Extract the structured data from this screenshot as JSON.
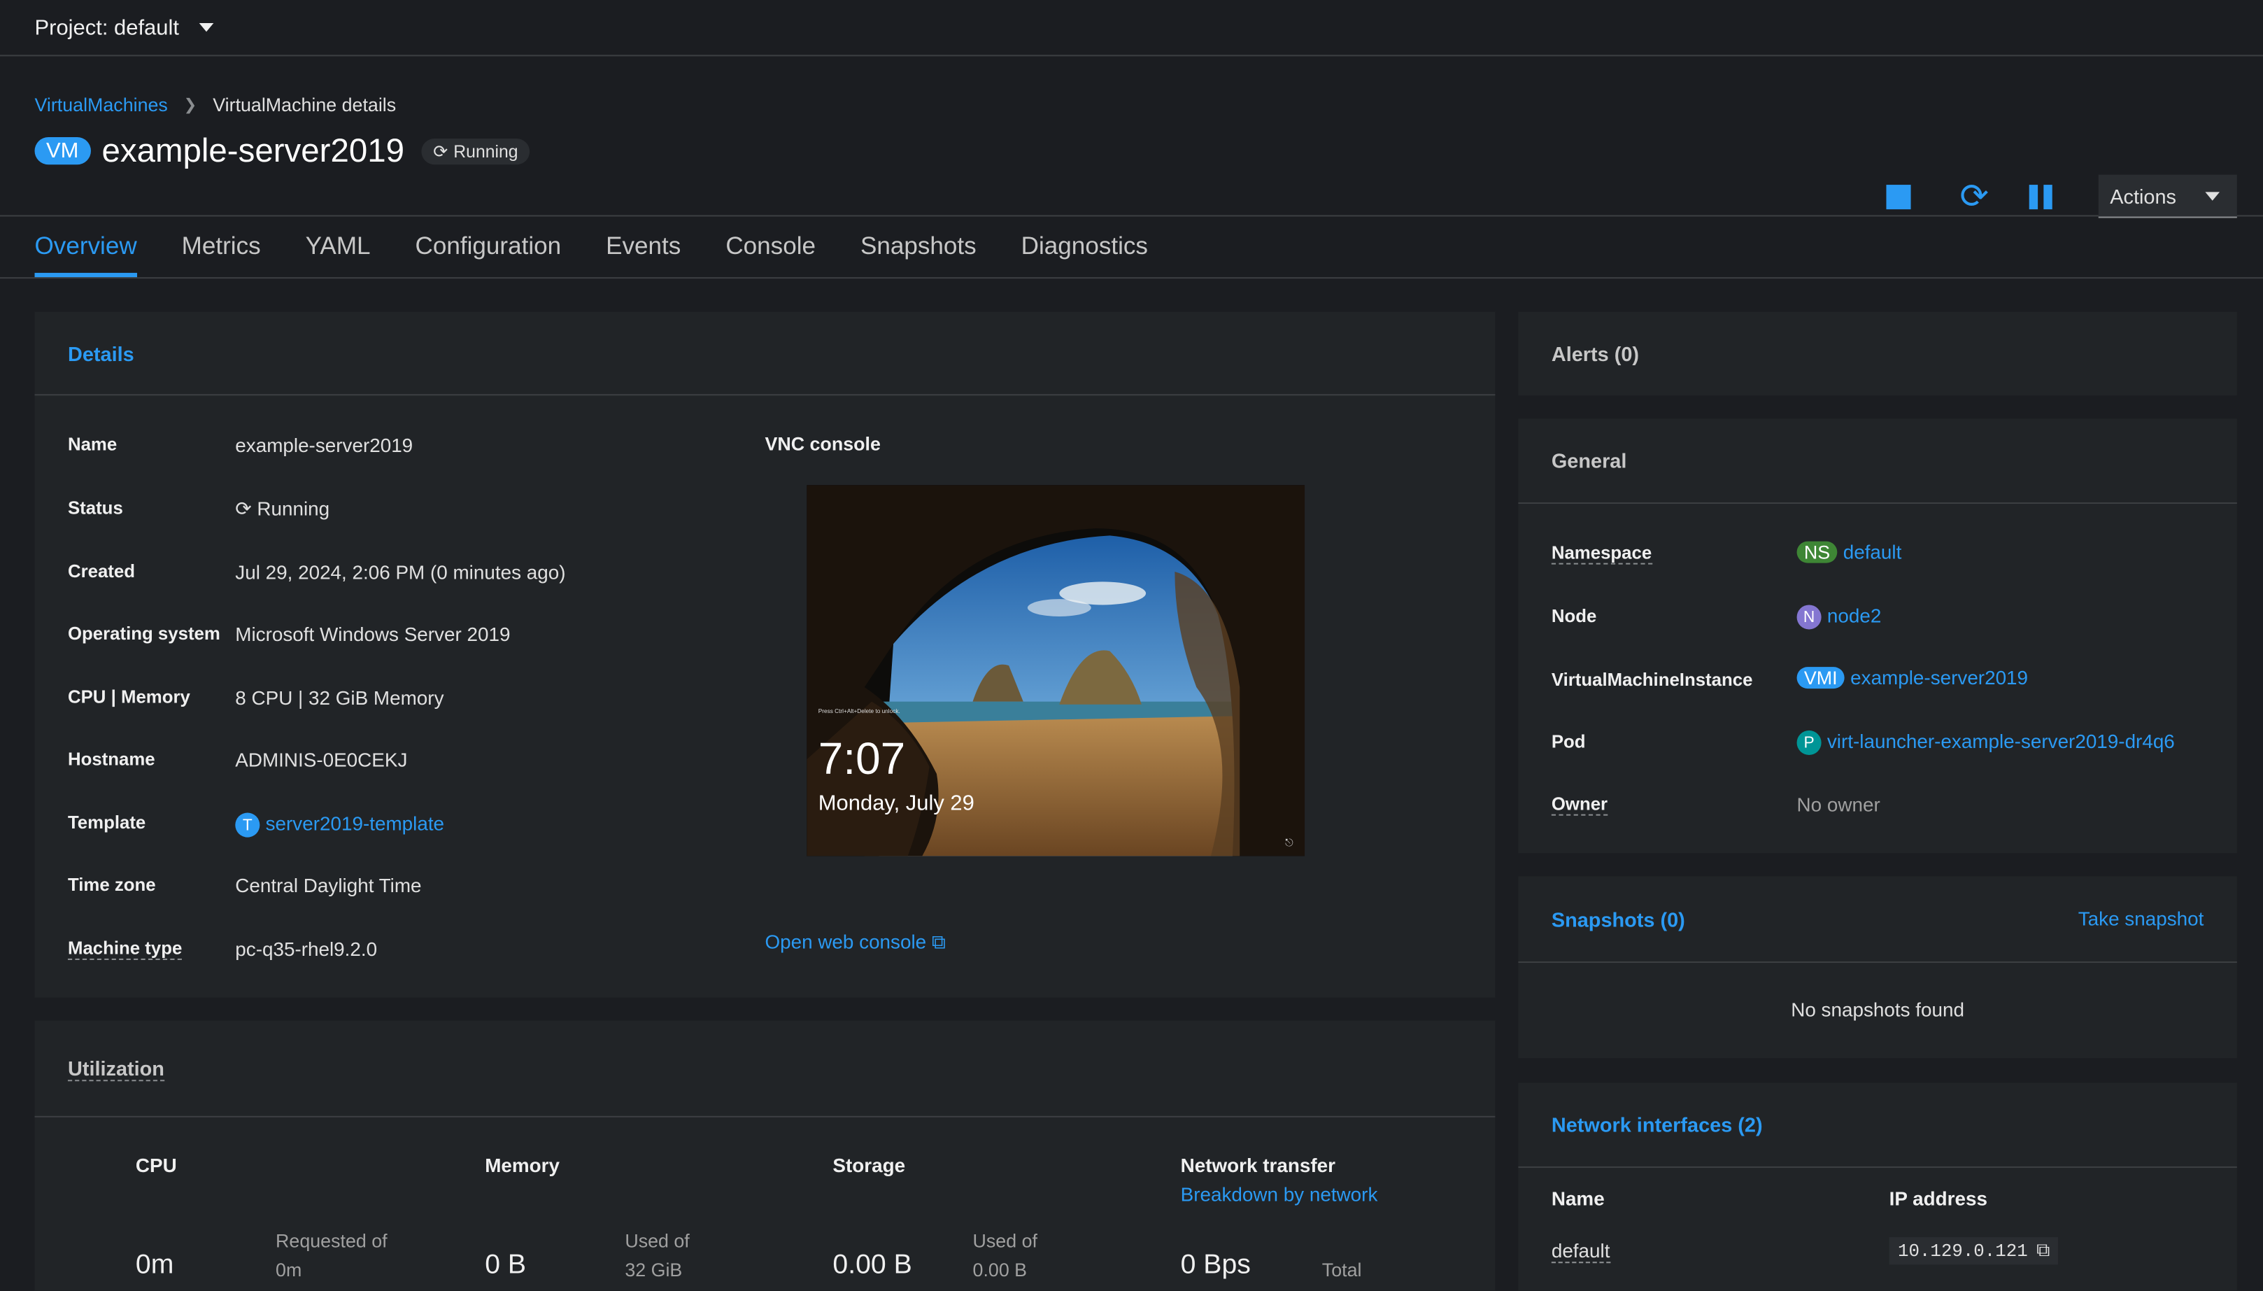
{
  "project": {
    "label": "Project: default"
  },
  "breadcrumb": {
    "parent": "VirtualMachines",
    "current": "VirtualMachine details"
  },
  "vm": {
    "badge": "VM",
    "name": "example-server2019",
    "status": "Running"
  },
  "header_actions": {
    "actions_label": "Actions",
    "stop": "stop-icon",
    "restart": "restart-icon",
    "pause": "pause-icon"
  },
  "tabs": [
    "Overview",
    "Metrics",
    "YAML",
    "Configuration",
    "Events",
    "Console",
    "Snapshots",
    "Diagnostics"
  ],
  "details": {
    "title": "Details",
    "rows": [
      {
        "label": "Name",
        "value": "example-server2019"
      },
      {
        "label": "Status",
        "value": "Running"
      },
      {
        "label": "Created",
        "value": "Jul 29, 2024, 2:06 PM (0 minutes ago)"
      },
      {
        "label": "Operating system",
        "value": "Microsoft Windows Server 2019"
      },
      {
        "label": "CPU | Memory",
        "value": "8 CPU | 32 GiB Memory"
      },
      {
        "label": "Hostname",
        "value": "ADMINIS-0E0CEKJ"
      },
      {
        "label": "Template",
        "badge": "T",
        "value": "server2019-template"
      },
      {
        "label": "Time zone",
        "value": "Central Daylight Time"
      },
      {
        "label": "Machine type",
        "value": "pc-q35-rhel9.2.0"
      }
    ],
    "vnc": {
      "title": "VNC console",
      "hint": "Press Ctrl+Alt+Delete to unlock.",
      "time": "7:07",
      "date": "Monday, July 29",
      "open_link": "Open web console"
    }
  },
  "utilization": {
    "title": "Utilization",
    "cpu": {
      "title": "CPU",
      "value": "0m",
      "sub1": "Requested of",
      "sub2": "0m"
    },
    "memory": {
      "title": "Memory",
      "value": "0 B",
      "sub1": "Used of",
      "sub2": "32 GiB"
    },
    "storage": {
      "title": "Storage",
      "value": "0.00 B",
      "sub1": "Used of",
      "sub2": "0.00 B"
    },
    "network": {
      "title": "Network transfer",
      "link": "Breakdown by network",
      "value": "0 Bps",
      "sub1": "Total"
    }
  },
  "alerts": {
    "title": "Alerts (0)"
  },
  "general": {
    "title": "General",
    "namespace": {
      "label": "Namespace",
      "badge": "NS",
      "value": "default"
    },
    "node": {
      "label": "Node",
      "badge": "N",
      "value": "node2"
    },
    "vmi": {
      "label": "VirtualMachineInstance",
      "badge": "VMI",
      "value": "example-server2019"
    },
    "pod": {
      "label": "Pod",
      "badge": "P",
      "value": "virt-launcher-example-server2019-dr4q6"
    },
    "owner": {
      "label": "Owner",
      "value": "No owner"
    }
  },
  "snapshots": {
    "title": "Snapshots (0)",
    "action": "Take snapshot",
    "empty": "No snapshots found"
  },
  "network_interfaces": {
    "title": "Network interfaces (2)",
    "col_name": "Name",
    "col_ip": "IP address",
    "rows": [
      {
        "name": "default",
        "ip": "10.129.0.121"
      }
    ]
  },
  "colors": {
    "accent": "#2b9af3",
    "background": "#1b1d21",
    "card": "#212427",
    "ns_badge": "#3e8635",
    "node_badge": "#8476d1",
    "pod_badge": "#009596"
  }
}
